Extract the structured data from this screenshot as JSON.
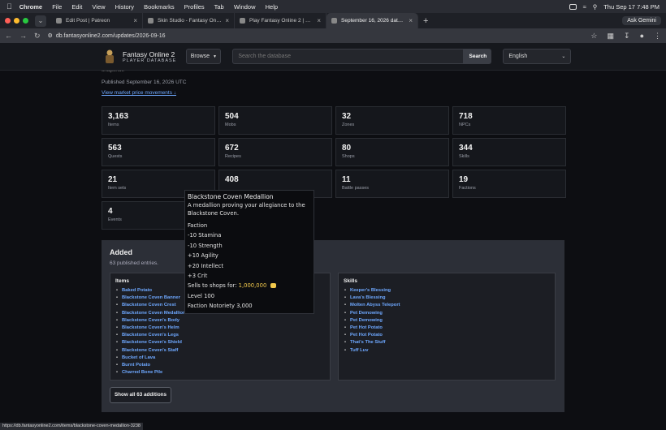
{
  "mac": {
    "app": "Chrome",
    "menus": [
      "File",
      "Edit",
      "View",
      "History",
      "Bookmarks",
      "Profiles",
      "Tab",
      "Window",
      "Help"
    ],
    "clock": "Thu Sep 17  7:48 PM"
  },
  "tabs": [
    {
      "title": "Edit Post | Patreon",
      "active": false
    },
    {
      "title": "Skin Studio - Fantasy Online 2",
      "active": false
    },
    {
      "title": "Play Fantasy Online 2 | Fanta",
      "active": false
    },
    {
      "title": "September 16, 2026 data rele",
      "active": true
    }
  ],
  "ask_gemini": "Ask Gemini",
  "address": {
    "url": "db.fantasyonline2.com/updates/2026-09-16"
  },
  "site": {
    "name": "Fantasy Online 2",
    "subtitle": "PLAYER DATABASE",
    "browse": "Browse",
    "search_placeholder": "Search the database",
    "search_button": "Search",
    "language": "English"
  },
  "page": {
    "fragment": "snapshot.",
    "published": "Published September 16, 2026 UTC",
    "market_link": "View market price movements ↓"
  },
  "stats": [
    {
      "value": "3,163",
      "label": "Items"
    },
    {
      "value": "504",
      "label": "Mobs"
    },
    {
      "value": "32",
      "label": "Zones"
    },
    {
      "value": "718",
      "label": "NPCs"
    },
    {
      "value": "563",
      "label": "Quests"
    },
    {
      "value": "672",
      "label": "Recipes"
    },
    {
      "value": "80",
      "label": "Shops"
    },
    {
      "value": "344",
      "label": "Skills"
    },
    {
      "value": "21",
      "label": "Item sets"
    },
    {
      "value": "408",
      "label": ""
    },
    {
      "value": "11",
      "label": "Battle passes"
    },
    {
      "value": "19",
      "label": "Factions"
    },
    {
      "value": "4",
      "label": "Events"
    }
  ],
  "added": {
    "heading": "Added",
    "summary": "63 published entries.",
    "items_heading": "Items",
    "items": [
      "Baked Potato",
      "Blackstone Coven Banner",
      "Blackstone Coven Crest",
      "Blackstone Coven Medallion",
      "Blackstone Coven's Body",
      "Blackstone Coven's Helm",
      "Blackstone Coven's Legs",
      "Blackstone Coven's Shield",
      "Blackstone Coven's Staff",
      "Bucket of Lava",
      "Burnt Potato",
      "Charred Bone Pile"
    ],
    "skills_heading": "Skills",
    "skills": [
      "Keeper's Blessing",
      "Lava's Blessing",
      "Molten Abyss Teleport",
      "Pet Demowing",
      "Pet Demowing",
      "Pet Hot Potato",
      "Pet Hot Potato",
      "That's The Stuff",
      "Tuff Luv"
    ],
    "show_all": "Show all 63 additions"
  },
  "tooltip": {
    "name": "Blackstone Coven Medallion",
    "description": "A medallion proving your allegiance to the Blackstone Coven.",
    "lines": [
      "Faction",
      "-10 Stamina",
      "-10 Strength",
      "+10 Agility",
      "+20 Intellect",
      "+3 Crit"
    ],
    "sells_label": "Sells to shops for:",
    "sells_value": "1,000,000",
    "level": "Level 100",
    "notoriety": "Faction Notoriety 3,000"
  },
  "status_url": "https://db.fantasyonline2.com/items/blackstone-coven-medallion-3238",
  "colors": {
    "link": "#6ea8ff",
    "gold": "#f2c94c",
    "bg": "#0d0e12",
    "panel": "#2c2f37"
  }
}
